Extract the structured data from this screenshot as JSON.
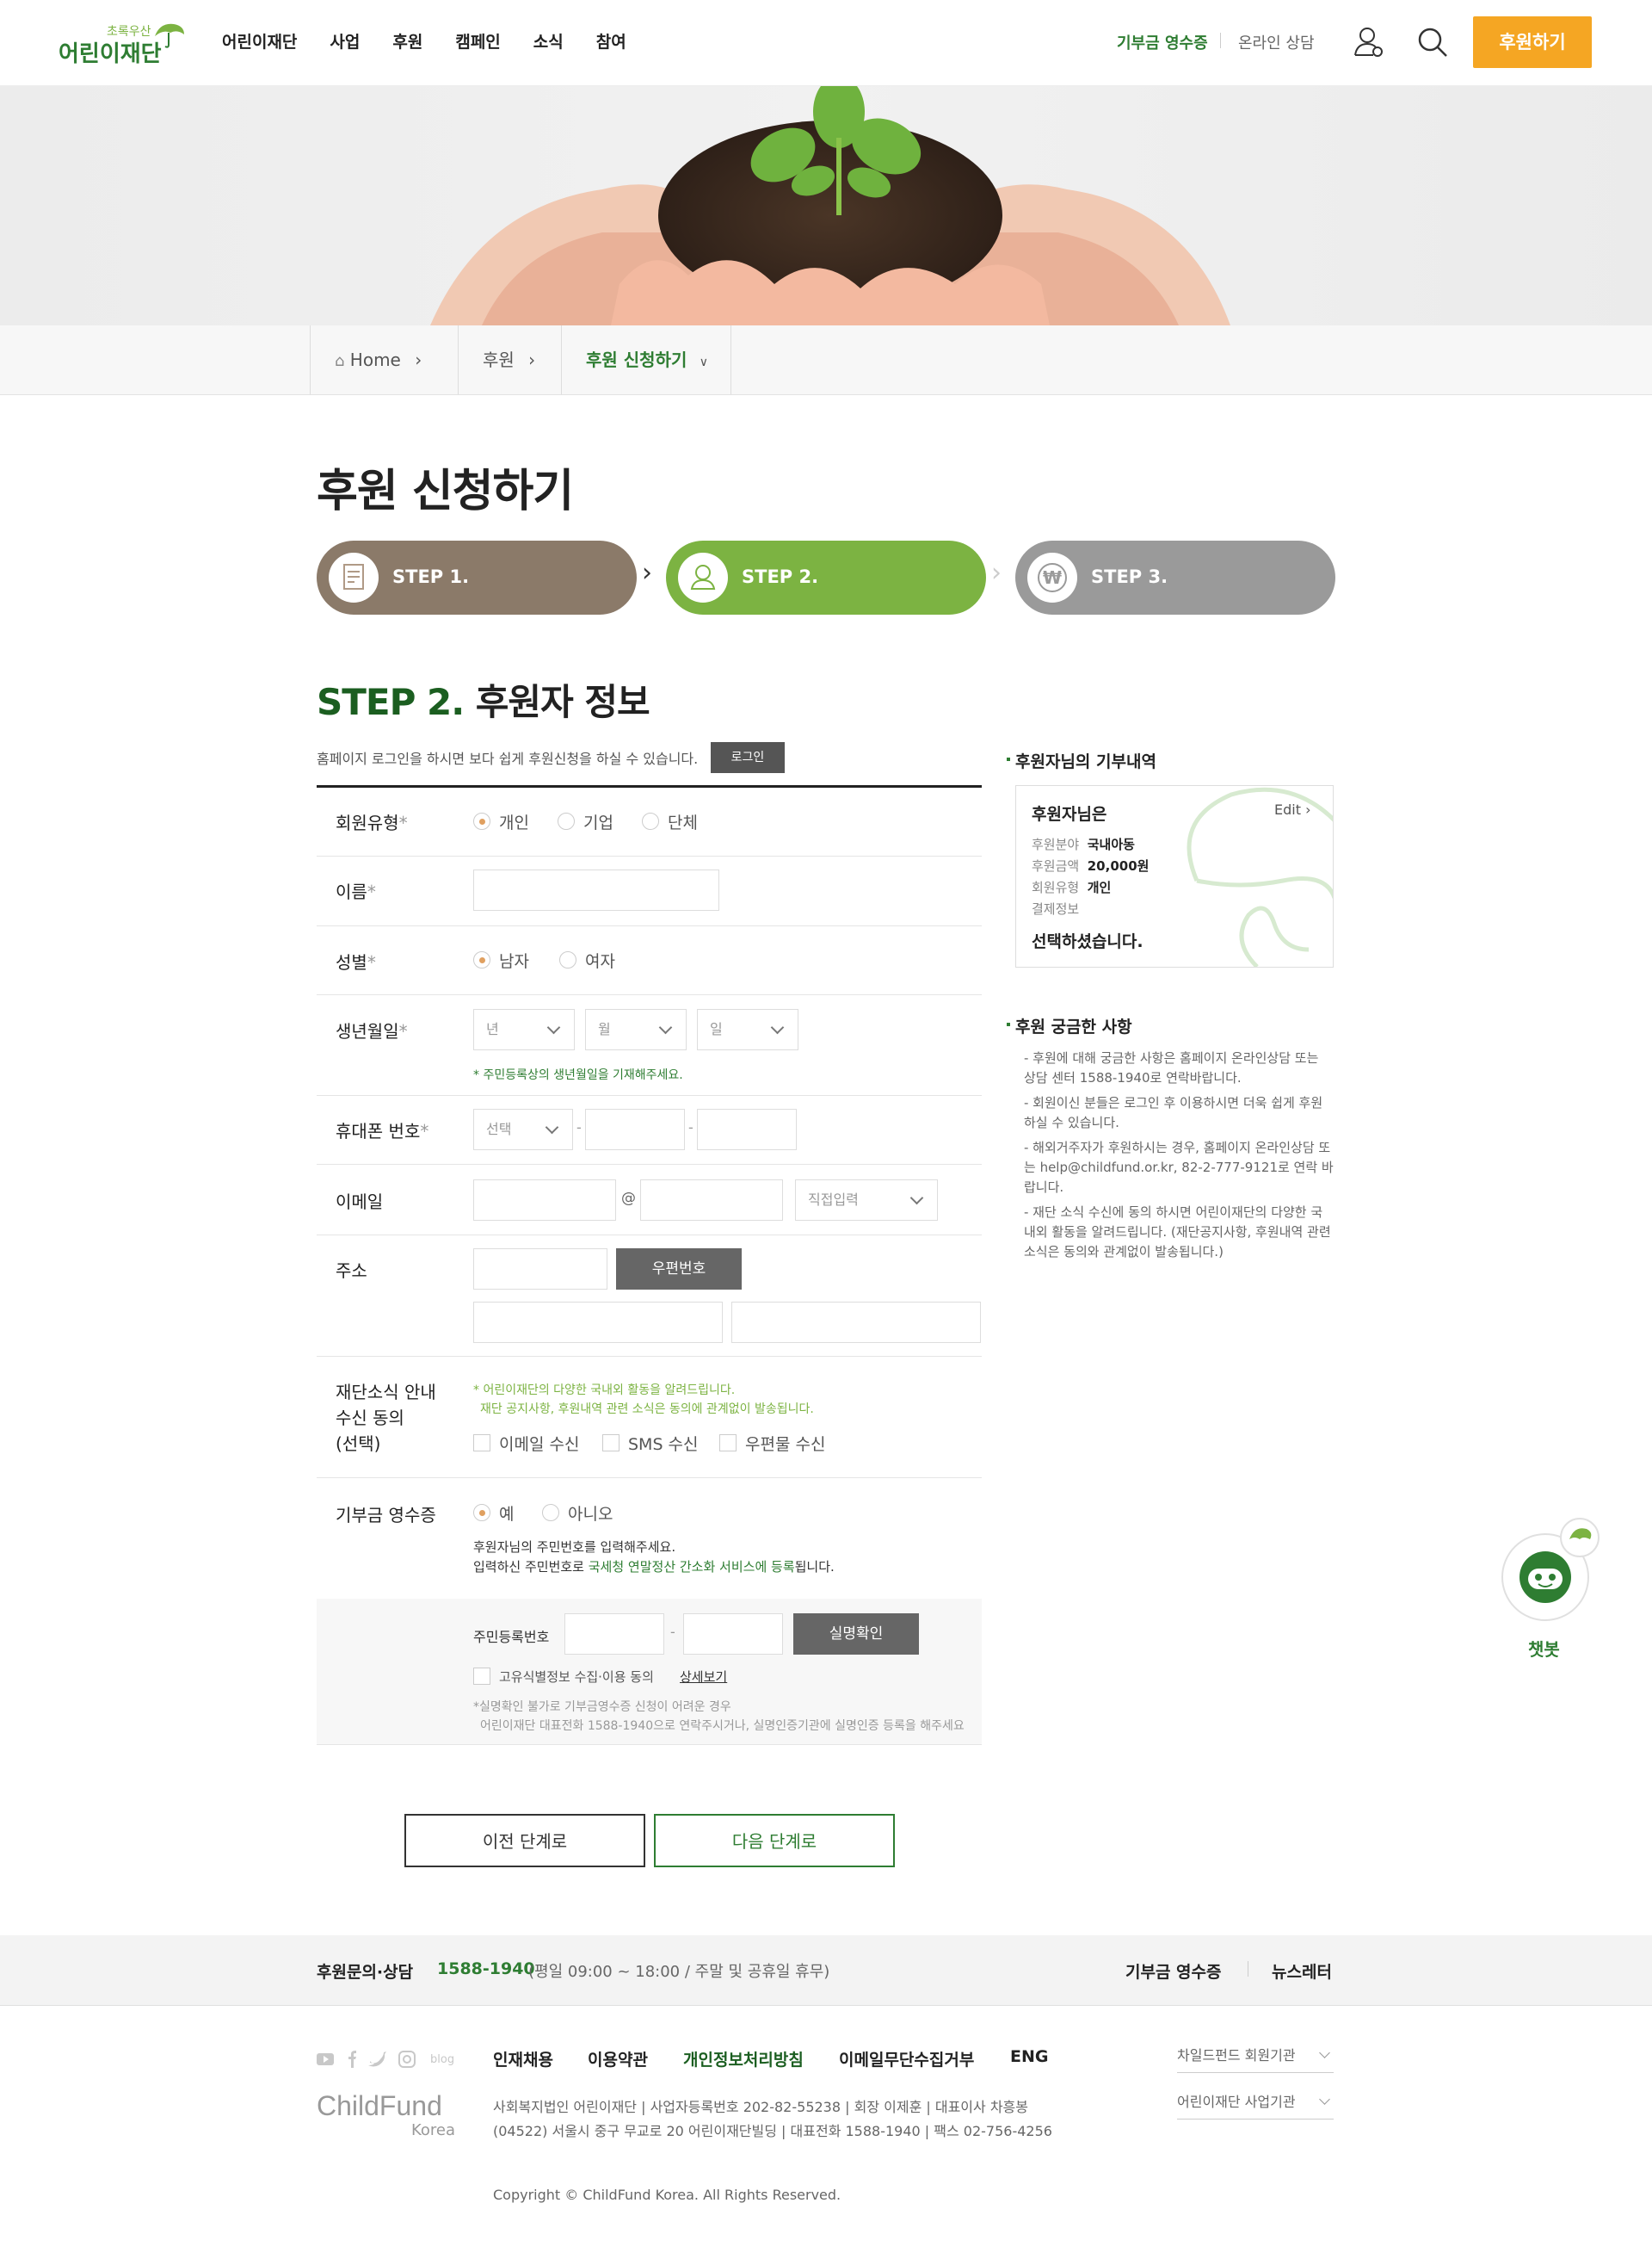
{
  "header": {
    "logo_small": "초록우산",
    "logo_main": "어린이재단",
    "nav": [
      "어린이재단",
      "사업",
      "후원",
      "캠페인",
      "소식",
      "참여"
    ],
    "util_receipt": "기부금 영수증",
    "util_consult": "온라인 상담",
    "donate_button": "후원하기",
    "colors": {
      "accent": "#f5a623",
      "brand_green": "#2e7d32"
    }
  },
  "breadcrumb": {
    "home": "Home",
    "level1": "후원",
    "current": "후원 신청하기"
  },
  "page_title": "후원 신청하기",
  "steps": [
    {
      "label": "STEP 1.",
      "color": "#8b7a69",
      "icon": "document-icon"
    },
    {
      "label": "STEP 2.",
      "color": "#7cb342",
      "icon": "person-icon"
    },
    {
      "label": "STEP 3.",
      "color": "#9a9a9a",
      "icon": "won-icon"
    }
  ],
  "section": {
    "title_prefix": "STEP 2.",
    "title": "후원자 정보",
    "notice": "홈페이지 로그인을 하시면 보다 쉽게 후원신청을 하실 수 있습니다.",
    "login_button": "로그인"
  },
  "form": {
    "member_type": {
      "label": "회원유형",
      "req": "*",
      "options": [
        "개인",
        "기업",
        "단체"
      ],
      "selected": "개인"
    },
    "name": {
      "label": "이름",
      "req": "*",
      "value": ""
    },
    "gender": {
      "label": "성별",
      "req": "*",
      "options": [
        "남자",
        "여자"
      ],
      "selected": "남자"
    },
    "birth": {
      "label": "생년월일",
      "req": "*",
      "year": "년",
      "month": "월",
      "day": "일",
      "help": "* 주민등록상의 생년월일을 기재해주세요."
    },
    "phone": {
      "label": "휴대폰 번호",
      "req": "*",
      "prefix": "선택",
      "dash": "-"
    },
    "email": {
      "label": "이메일",
      "at": "@",
      "domain_select": "직접입력"
    },
    "address": {
      "label": "주소",
      "zip_button": "우편번호"
    },
    "news": {
      "label1": "재단소식 안내",
      "label2": "수신 동의",
      "label3": "(선택)",
      "help1": "* 어린이재단의 다양한 국내외 활동을 알려드립니다.",
      "help2": "재단 공지사항, 후원내역 관련 소식은 동의에 관계없이 발송됩니다.",
      "options": [
        "이메일 수신",
        "SMS 수신",
        "우편물 수신"
      ]
    },
    "receipt": {
      "label": "기부금 영수증",
      "options": [
        "예",
        "아니오"
      ],
      "selected": "예",
      "desc1": "후원자님의 주민번호를 입력해주세요.",
      "desc2_pre": "입력하신 주민번호로 ",
      "desc2_highlight": "국세청 연말정산 간소화 서비스에 등록",
      "desc2_post": "됩니다.",
      "ssn_label": "주민등록번호",
      "verify_button": "실명확인",
      "consent": "고유식별정보 수집·이용 동의",
      "detail_link": "상세보기",
      "note1": "*실명확인 불가로 기부금영수증 신청이 어려운 경우",
      "note2": "어린이재단 대표전화 1588-1940으로 연락주시거나, 실명인증기관에 실명인증 등록을 해주세요"
    }
  },
  "buttons": {
    "prev": "이전 단계로",
    "next": "다음 단계로"
  },
  "sidebar": {
    "history_title": "후원자님의 기부내역",
    "box": {
      "heading": "후원자님은",
      "edit": "Edit",
      "rows": [
        {
          "k": "후원분야",
          "v": "국내아동"
        },
        {
          "k": "후원금액",
          "v": "20,000원"
        },
        {
          "k": "회원유형",
          "v": "개인"
        },
        {
          "k": "결제정보",
          "v": ""
        }
      ],
      "footer": "선택하셨습니다."
    },
    "faq_title": "후원 궁금한 사항",
    "faq": [
      "- 후원에 대해 궁금한 사항은 홈페이지 온라인상담 또는 상담 센터 1588-1940로 연락바랍니다.",
      "- 회원이신 분들은 로그인 후 이용하시면 더욱 쉽게 후원 하실 수 있습니다.",
      "- 해외거주자가 후원하시는 경우, 홈페이지 온라인상담 또는 help@childfund.or.kr, 82-2-777-9121로 연락 바랍니다.",
      "- 재단 소식 수신에 동의 하시면 어린이재단의 다양한 국내외 활동을 알려드립니다. (재단공지사항, 후원내역 관련 소식은 동의와 관계없이 발송됩니다.)"
    ]
  },
  "chatbot": {
    "label": "챗봇"
  },
  "contact": {
    "label": "후원문의·상담",
    "phone": "1588-1940",
    "hours": "(평일 09:00 ~ 18:00 / 주말 및 공휴일 휴무)",
    "link1": "기부금 영수증",
    "link2": "뉴스레터"
  },
  "footer": {
    "sns": [
      "youtube-icon",
      "facebook-icon",
      "twitter-icon",
      "instagram-icon",
      "blog-icon"
    ],
    "blog_label": "blog",
    "menu": [
      "인재채용",
      "이용약관",
      "개인정보처리방침",
      "이메일무단수집거부",
      "ENG"
    ],
    "logo_main": "ChildFund",
    "logo_sub": "Korea",
    "info1": "사회복지법인 어린이재단  |  사업자등록번호 202-82-55238  |  회장 이제훈  |  대표이사 차흥봉",
    "info2": "(04522) 서울시 중구 무교로 20 어린이재단빌딩  |  대표전화 1588-1940  |  팩스 02-756-4256",
    "copyright": "Copyright © ChildFund Korea. All Rights Reserved.",
    "family1": "차일드펀드 회원기관",
    "family2": "어린이재단 사업기관"
  }
}
